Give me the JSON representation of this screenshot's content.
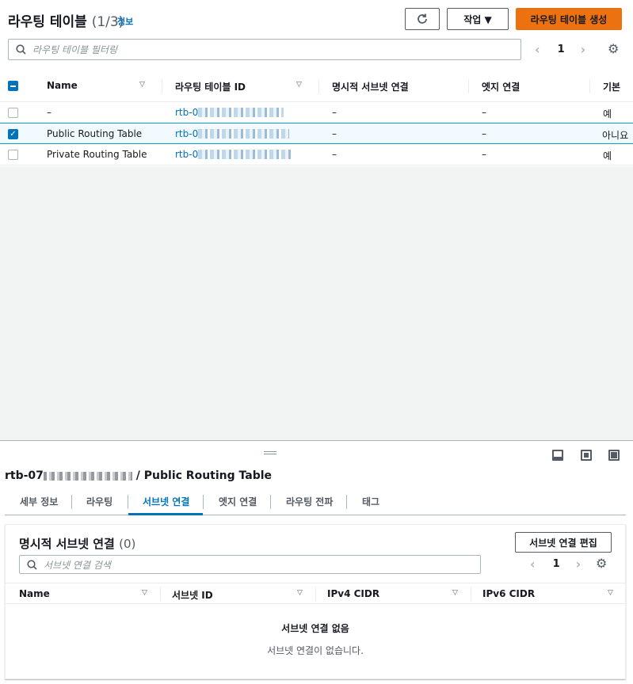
{
  "header": {
    "title": "라우팅 테이블",
    "count": "(1/3)",
    "info_link": "정보",
    "refresh_icon": "refresh-icon",
    "actions_label": "작업 ▼",
    "create_label": "라우팅 테이블 생성"
  },
  "filter": {
    "placeholder": "라우팅 테이블 필터링"
  },
  "pager": {
    "page": "1"
  },
  "table": {
    "columns": [
      "Name",
      "라우팅 테이블 ID",
      "명시적 서브넷 연결",
      "엣지 연결",
      "기본"
    ],
    "rows": [
      {
        "name": "–",
        "id": "rtb-0",
        "subnet": "–",
        "edge": "–",
        "main": "예",
        "selected": false
      },
      {
        "name": "Public Routing Table",
        "id": "rtb-0",
        "subnet": "–",
        "edge": "–",
        "main": "아니요",
        "selected": true
      },
      {
        "name": "Private Routing Table",
        "id": "rtb-0",
        "subnet": "–",
        "edge": "–",
        "main": "예",
        "selected": false
      }
    ]
  },
  "detail": {
    "title_prefix": "rtb-07",
    "title_suffix": "/ Public Routing Table",
    "tabs": [
      "세부 정보",
      "라우팅",
      "서브넷 연결",
      "엣지 연결",
      "라우팅 전파",
      "태그"
    ],
    "active_tab": "서브넷 연결",
    "section_title": "명시적 서브넷 연결",
    "section_count": "(0)",
    "edit_button": "서브넷 연결 편집",
    "search_placeholder": "서브넷 연결 검색",
    "page": "1",
    "columns": [
      "Name",
      "서브넷 ID",
      "IPv4 CIDR",
      "IPv6 CIDR"
    ],
    "empty_title": "서브넷 연결 없음",
    "empty_text": "서브넷 연결이 없습니다."
  },
  "colors": {
    "accent": "#0073bb",
    "primary_button": "#ec7211"
  }
}
